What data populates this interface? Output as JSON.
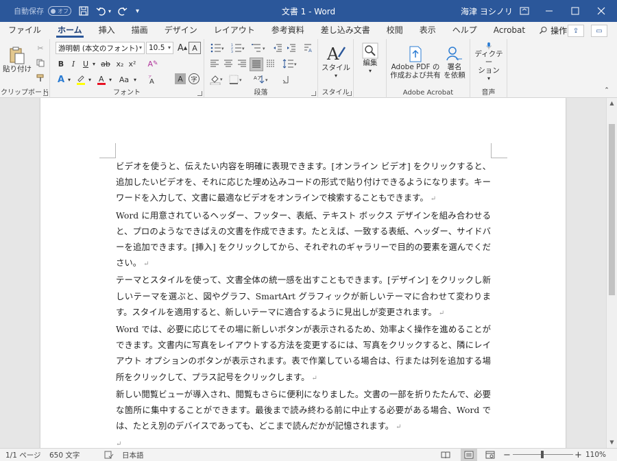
{
  "titlebar": {
    "autosave_label": "自動保存",
    "autosave_state": "オフ",
    "document_title": "文書 1  -  Word",
    "user_name": "海津 ヨシノリ"
  },
  "tabs": [
    "ファイル",
    "ホーム",
    "挿入",
    "描画",
    "デザイン",
    "レイアウト",
    "参考資料",
    "差し込み文書",
    "校閲",
    "表示",
    "ヘルプ",
    "Acrobat"
  ],
  "active_tab": "ホーム",
  "tell_me": "操作アシ",
  "ribbon": {
    "clipboard": {
      "label": "クリップボード",
      "paste": "貼り付け"
    },
    "font": {
      "label": "フォント",
      "font_name": "游明朝 (本文のフォント)",
      "font_size": "10.5",
      "bold": "B",
      "italic": "I",
      "underline": "U",
      "strike": "ab",
      "subscript": "x₂",
      "superscript": "x²",
      "grow": "A",
      "shrink": "A",
      "case": "Aa",
      "clear": "A",
      "char_border": "A",
      "char_shade": "A",
      "enclose": "字"
    },
    "paragraph": {
      "label": "段落"
    },
    "styles": {
      "label": "スタイル",
      "button": "スタイル"
    },
    "editing": {
      "button": "編集"
    },
    "acrobat": {
      "label": "Adobe Acrobat",
      "create_pdf": "Adobe PDF の\n作成および共有",
      "sign": "署名\nを依頼"
    },
    "voice": {
      "label": "音声",
      "dictate": "ディクテー\nション"
    }
  },
  "document": {
    "paragraphs": [
      "ビデオを使うと、伝えたい内容を明確に表現できます。[オンライン ビデオ] をクリックすると、追加したいビデオを、それに応じた埋め込みコードの形式で貼り付けできるようになります。キーワードを入力して、文書に最適なビデオをオンラインで検索することもできます。",
      "Word に用意されているヘッダー、フッター、表紙、テキスト ボックス デザインを組み合わせると、プロのようなできばえの文書を作成できます。たとえば、一致する表紙、ヘッダー、サイドバーを追加できます。[挿入] をクリックしてから、それぞれのギャラリーで目的の要素を選んでください。",
      "テーマとスタイルを使って、文書全体の統一感を出すこともできます。[デザイン] をクリックし新しいテーマを選ぶと、図やグラフ、SmartArt グラフィックが新しいテーマに合わせて変わります。スタイルを適用すると、新しいテーマに適合するように見出しが変更されます。",
      "Word では、必要に応じてその場に新しいボタンが表示されるため、効率よく操作を進めることができます。文書内に写真をレイアウトする方法を変更するには、写真をクリックすると、隣にレイアウト オプションのボタンが表示されます。表で作業している場合は、行または列を追加する場所をクリックして、プラス記号をクリックします。",
      "新しい閲覧ビューが導入され、閲覧もさらに便利になりました。文書の一部を折りたたんで、必要な箇所に集中することができます。最後まで読み終わる前に中止する必要がある場合、Word では、たとえ別のデバイスであっても、どこまで読んだかが記憶されます。"
    ],
    "paragraph_mark": "↵"
  },
  "status": {
    "page": "1/1 ページ",
    "words": "650 文字",
    "language": "日本語",
    "zoom": "110%"
  },
  "colors": {
    "accent": "#2b579a"
  }
}
